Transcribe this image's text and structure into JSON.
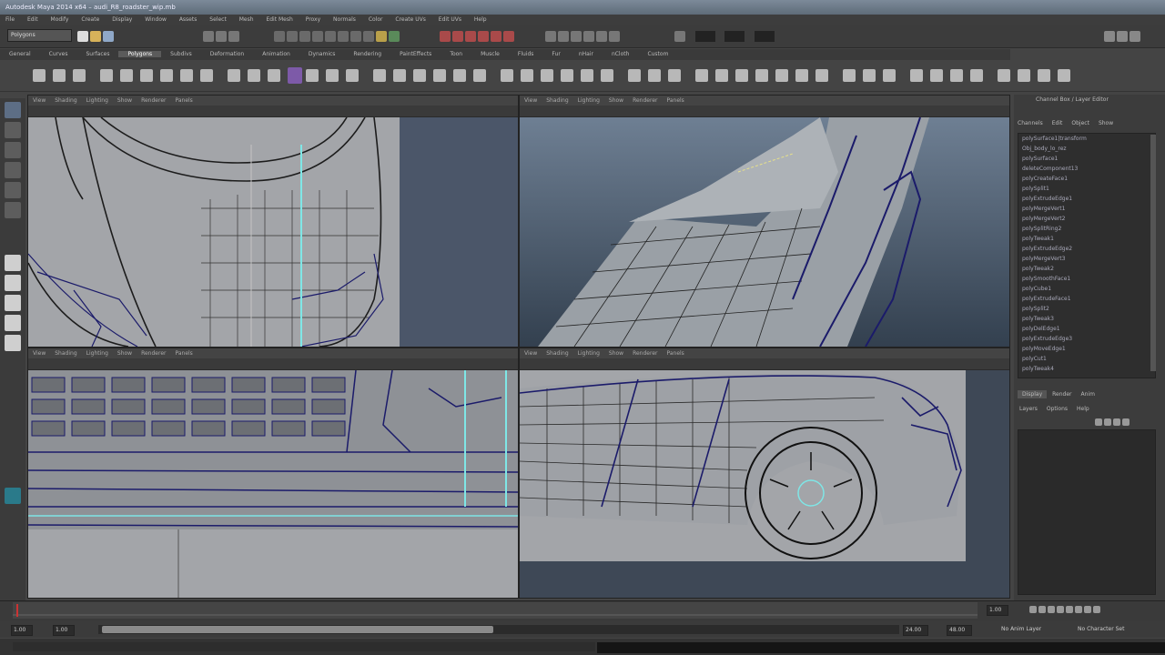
{
  "window": {
    "title": "Autodesk Maya 2014 x64 – audi_R8_roadster_wip.mb"
  },
  "menubar": {
    "items": [
      "File",
      "Edit",
      "Modify",
      "Create",
      "Display",
      "Window",
      "Assets",
      "Select",
      "Mesh",
      "Edit Mesh",
      "Proxy",
      "Normals",
      "Color",
      "Create UVs",
      "Edit UVs",
      "Help"
    ]
  },
  "statusline": {
    "mode": "Polygons"
  },
  "shelf": {
    "tabs": [
      "General",
      "Curves",
      "Surfaces",
      "Polygons",
      "Subdivs",
      "Deformation",
      "Animation",
      "Dynamics",
      "Rendering",
      "PaintEffects",
      "Toon",
      "Muscle",
      "Fluids",
      "Fur",
      "nHair",
      "nCloth",
      "Custom"
    ],
    "active_tab": "Polygons"
  },
  "panels": {
    "menu_items": [
      "View",
      "Shading",
      "Lighting",
      "Show",
      "Renderer",
      "Panels"
    ],
    "top_left": {
      "name": "persp"
    },
    "top_right": {
      "name": "persp"
    },
    "bottom_left": {
      "name": "front"
    },
    "bottom_right": {
      "name": "side"
    }
  },
  "channel_box": {
    "title": "Channel Box / Layer Editor",
    "tabs": [
      "Channels",
      "Edit",
      "Object",
      "Show"
    ]
  },
  "outliner": {
    "items": [
      "polySurface1|transform",
      "Obj_body_lo_rez",
      "polySurface1",
      "deleteComponent13",
      "polyCreateFace1",
      "polySplit1",
      "polyExtrudeEdge1",
      "polyMergeVert1",
      "polyMergeVert2",
      "polySplitRing2",
      "polyTweak1",
      "polyExtrudeEdge2",
      "polyMergeVert3",
      "polyTweak2",
      "polySmoothFace1",
      "polyCube1",
      "polyExtrudeFace1",
      "polySplit2",
      "polyTweak3",
      "polyDelEdge1",
      "polyExtrudeEdge3",
      "polyMoveEdge1",
      "polyCut1",
      "polyTweak4",
      "polyMergeVert4",
      "polySplitRing3"
    ]
  },
  "layers": {
    "tabs": [
      "Display",
      "Render",
      "Anim"
    ],
    "menu": [
      "Layers",
      "Options",
      "Help"
    ]
  },
  "timeline": {
    "start": "1.00",
    "end": "24.00",
    "range_start": "1.00",
    "range_end": "24.00",
    "anim_end": "48.00",
    "current": "1.00"
  },
  "range": {
    "anim_layer": "No Anim Layer",
    "char_set": "No Character Set"
  },
  "colors": {
    "accent": "#5b8cc7",
    "wire_dark": "#1b1b6a",
    "wire_select": "#7fe6e6",
    "viewport_grey": "#a3a5a9",
    "viewport_bg": "#4a5566"
  }
}
